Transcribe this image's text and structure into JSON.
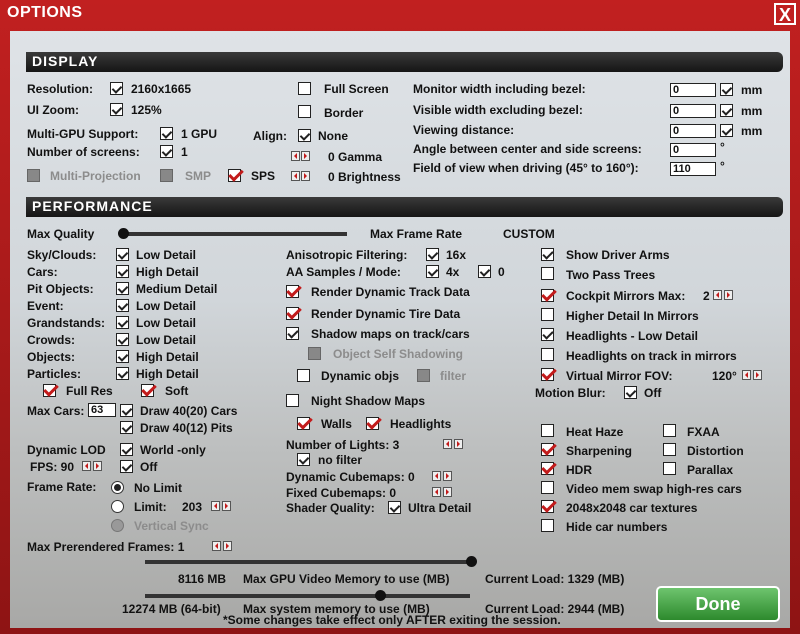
{
  "window": {
    "title": "OPTIONS",
    "close": "X"
  },
  "display": {
    "header": "DISPLAY",
    "resolution_label": "Resolution:",
    "resolution": "2160x1665",
    "uizoom_label": "UI Zoom:",
    "uizoom": "125%",
    "multigpu_label": "Multi-GPU Support:",
    "multigpu": "1 GPU",
    "screens_label": "Number of screens:",
    "screens": "1",
    "multiproj": "Multi-Projection",
    "smp": "SMP",
    "sps": "SPS",
    "fullscreen": "Full Screen",
    "border": "Border",
    "align_label": "Align:",
    "align": "None",
    "gamma": "0  Gamma",
    "brightness": "0  Brightness",
    "mon_width_label": "Monitor width including bezel:",
    "mon_width": "0",
    "vis_width_label": "Visible width excluding bezel:",
    "vis_width": "0",
    "view_dist_label": "Viewing distance:",
    "view_dist": "0",
    "angle_label": "Angle between center and side screens:",
    "angle": "0",
    "fov_label": "Field of view when driving (45° to 160°):",
    "fov": "110",
    "mm": "mm",
    "deg": "°"
  },
  "performance": {
    "header": "PERFORMANCE",
    "max_quality": "Max Quality",
    "max_frame_rate": "Max Frame Rate",
    "custom": "CUSTOM",
    "rows": [
      {
        "label": "Sky/Clouds:",
        "value": "Low Detail"
      },
      {
        "label": "Cars:",
        "value": "High Detail"
      },
      {
        "label": "Pit Objects:",
        "value": "Medium Detail"
      },
      {
        "label": "Event:",
        "value": "Low Detail"
      },
      {
        "label": "Grandstands:",
        "value": "Low Detail"
      },
      {
        "label": "Crowds:",
        "value": "Low Detail"
      },
      {
        "label": "Objects:",
        "value": "High Detail"
      },
      {
        "label": "Particles:",
        "value": "High Detail"
      }
    ],
    "full_res": "Full Res",
    "soft": "Soft",
    "max_cars_label": "Max Cars:",
    "max_cars": "63",
    "draw_cars": "Draw 40(20) Cars",
    "draw_pits": "Draw 40(12) Pits",
    "dynamic_lod_label": "Dynamic LOD",
    "dynamic_lod": "World -only",
    "fps_label": "FPS: 90",
    "fps_off": "Off",
    "frame_rate_label": "Frame Rate:",
    "no_limit": "No Limit",
    "limit_label": "Limit:",
    "limit": "203",
    "vsync": "Vertical Sync",
    "max_prerendered": "Max Prerendered Frames: 1",
    "aniso_label": "Anisotropic Filtering:",
    "aniso": "16x",
    "aa_label": "AA Samples / Mode:",
    "aa": "4x",
    "aa_mode": "0",
    "render_track": "Render Dynamic Track Data",
    "render_tire": "Render Dynamic Tire Data",
    "shadow_maps": "Shadow maps on track/cars",
    "object_self": "Object Self Shadowing",
    "dynamic_objs": "Dynamic objs",
    "filter": "filter",
    "night_shadow": "Night Shadow Maps",
    "walls": "Walls",
    "headlights": "Headlights",
    "num_lights": "Number of Lights: 3",
    "no_filter": "no filter",
    "dyn_cube": "Dynamic Cubemaps: 0",
    "fixed_cube": "Fixed Cubemaps: 0",
    "shader_label": "Shader Quality:",
    "shader": "Ultra Detail",
    "show_arms": "Show Driver Arms",
    "two_pass": "Two Pass Trees",
    "cockpit_mirrors": "Cockpit Mirrors  Max:",
    "cockpit_max": "2",
    "higher_detail": "Higher Detail In Mirrors",
    "headlights_low": "Headlights - Low Detail",
    "headlights_track": "Headlights on track in mirrors",
    "virtual_mirror": "Virtual Mirror   FOV:",
    "vm_fov": "120°",
    "motion_blur_label": "Motion Blur:",
    "motion_blur": "Off",
    "heat_haze": "Heat Haze",
    "fxaa": "FXAA",
    "sharpening": "Sharpening",
    "distortion": "Distortion",
    "hdr": "HDR",
    "parallax": "Parallax",
    "video_swap": "Video mem swap high-res cars",
    "textures": "2048x2048 car textures",
    "hide_numbers": "Hide car numbers",
    "gpu_mem": "8116 MB",
    "gpu_mem_label": "Max GPU Video Memory to use (MB)",
    "gpu_load": "Current Load: 1329 (MB)",
    "sys_mem": "12274 MB (64-bit)",
    "sys_mem_label": "Max system memory to use (MB)",
    "sys_load": "Current Load: 2944 (MB)",
    "note": "*Some changes take effect only AFTER exiting the session.",
    "done": "Done"
  },
  "colors": {
    "accent": "#c12020",
    "done": "#3a9a3a"
  }
}
